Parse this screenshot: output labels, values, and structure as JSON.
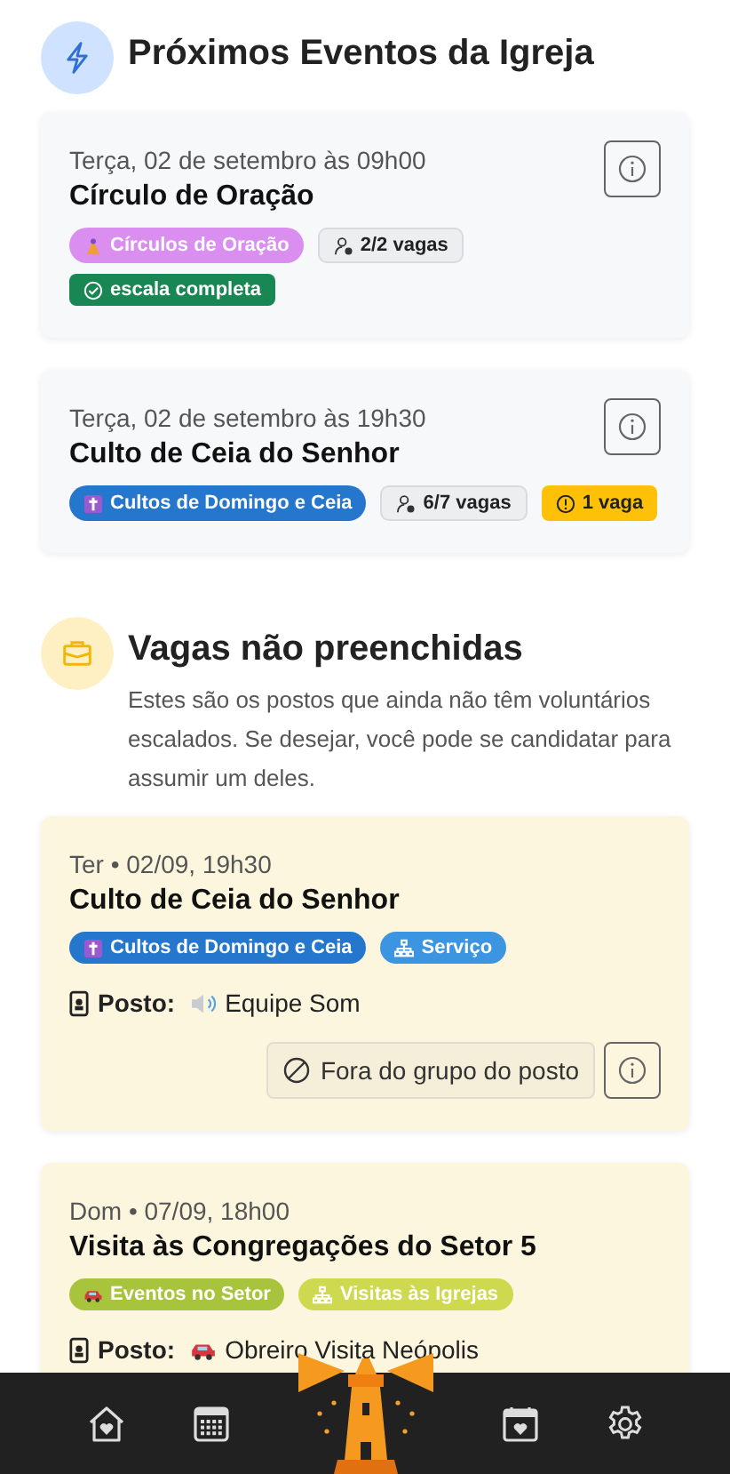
{
  "sections": [
    {
      "kind": "events",
      "title": "Próximos Eventos da Igreja",
      "cards": [
        {
          "date": "Terça, 02 de setembro às 09h00",
          "title": "Círculo de Oração",
          "badges": [
            {
              "kind": "prayer",
              "text": "Círculos de Oração",
              "color": "#d98ef0"
            },
            {
              "kind": "slots",
              "text": "2/2 vagas"
            },
            {
              "kind": "complete",
              "text": "escala completa"
            }
          ]
        },
        {
          "date": "Terça, 02 de setembro às 19h30",
          "title": "Culto de Ceia do Senhor",
          "badges": [
            {
              "kind": "cross",
              "text": "Cultos de Domingo e Ceia",
              "color": "#2477cc"
            },
            {
              "kind": "slots",
              "text": "6/7 vagas"
            },
            {
              "kind": "warning",
              "text": "1 vaga"
            }
          ]
        }
      ]
    },
    {
      "kind": "vacancies",
      "title": "Vagas não preenchidas",
      "description": "Estes são os postos que ainda não têm voluntários escalados. Se desejar, você pode se candidatar para assumir um deles.",
      "cards": [
        {
          "date": "Ter • 02/09, 19h30",
          "title": "Culto de Ceia do Senhor",
          "badges": [
            {
              "kind": "cross",
              "text": "Cultos de Domingo e Ceia",
              "color": "#2477cc"
            },
            {
              "kind": "network",
              "text": "Serviço",
              "color": "#3b95e0"
            }
          ],
          "post": {
            "label": "Posto:",
            "kind": "sound",
            "name": "Equipe Som"
          },
          "action": {
            "text": "Fora do grupo do posto",
            "disabled": true
          }
        },
        {
          "date": "Dom • 07/09, 18h00",
          "title": "Visita às Congregações do Setor 5",
          "badges": [
            {
              "kind": "car",
              "text": "Eventos no Setor",
              "color": "#a8c43c"
            },
            {
              "kind": "network",
              "text": "Visitas às Igrejas",
              "color": "#cfd94f"
            }
          ],
          "post": {
            "label": "Posto:",
            "kind": "car",
            "name": "Obreiro Visita Neópolis"
          }
        }
      ]
    }
  ],
  "nav": [
    {
      "kind": "home"
    },
    {
      "kind": "calendar"
    },
    {
      "kind": "lighthouse"
    },
    {
      "kind": "favorites"
    },
    {
      "kind": "settings"
    }
  ]
}
